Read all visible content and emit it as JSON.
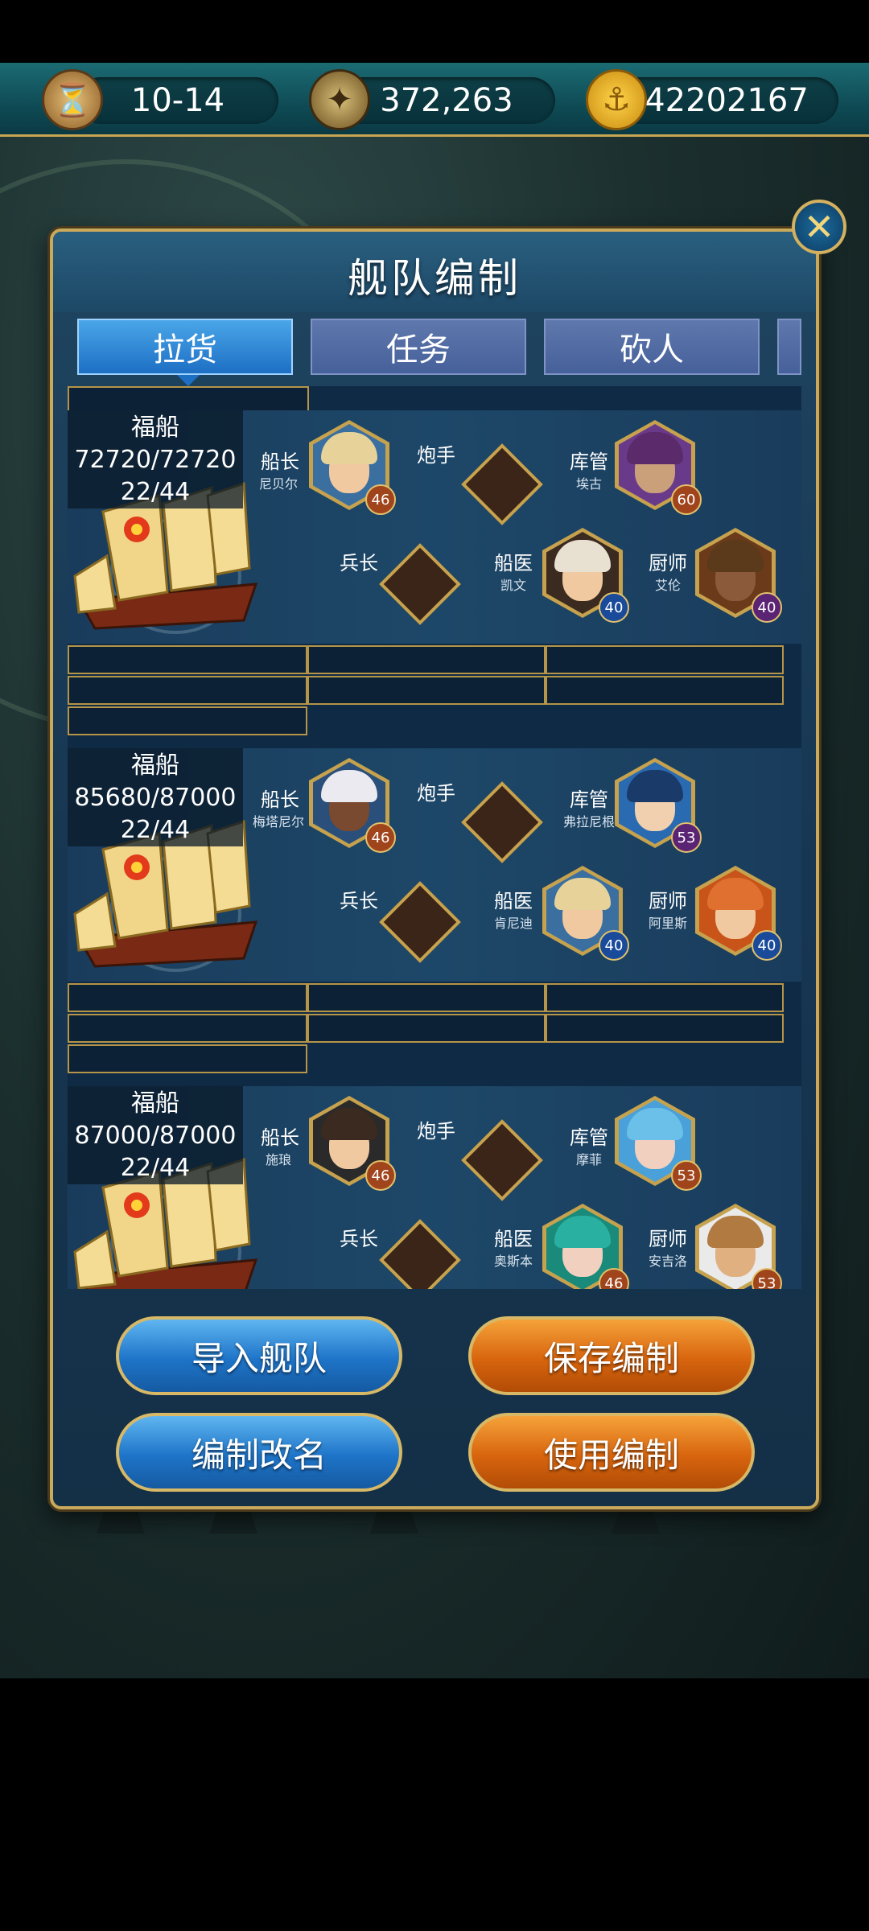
{
  "resources": {
    "date": "10-14",
    "silver": "372,263",
    "gold": "42202167"
  },
  "dialog": {
    "title": "舰队编制",
    "close_icon": "✕"
  },
  "tabs": [
    "拉货",
    "任务",
    "砍人"
  ],
  "role_labels": {
    "captain": "船长",
    "gunner": "炮手",
    "quartermaster": "库管",
    "soldier": "兵长",
    "doctor": "船医",
    "cook": "厨师"
  },
  "fleets": [
    {
      "ship": "福船",
      "durability": "72720/72720",
      "crew": "22/44",
      "captain": {
        "name": "尼贝尔",
        "level": "46"
      },
      "quartermaster": {
        "name": "埃古",
        "level": "60"
      },
      "doctor": {
        "name": "凯文",
        "level": "40"
      },
      "cook": {
        "name": "艾伦",
        "level": "40"
      }
    },
    {
      "ship": "福船",
      "durability": "85680/87000",
      "crew": "22/44",
      "captain": {
        "name": "梅塔尼尔",
        "level": "46"
      },
      "quartermaster": {
        "name": "弗拉尼根",
        "level": "53"
      },
      "doctor": {
        "name": "肯尼迪",
        "level": "40"
      },
      "cook": {
        "name": "阿里斯",
        "level": "40"
      }
    },
    {
      "ship": "福船",
      "durability": "87000/87000",
      "crew": "22/44",
      "captain": {
        "name": "施琅",
        "level": "46"
      },
      "quartermaster": {
        "name": "摩菲",
        "level": "53"
      },
      "doctor": {
        "name": "奥斯本",
        "level": "46"
      },
      "cook": {
        "name": "安吉洛",
        "level": "53"
      }
    }
  ],
  "buttons": {
    "import": "导入舰队",
    "save": "保存编制",
    "rename": "编制改名",
    "use": "使用编制"
  }
}
